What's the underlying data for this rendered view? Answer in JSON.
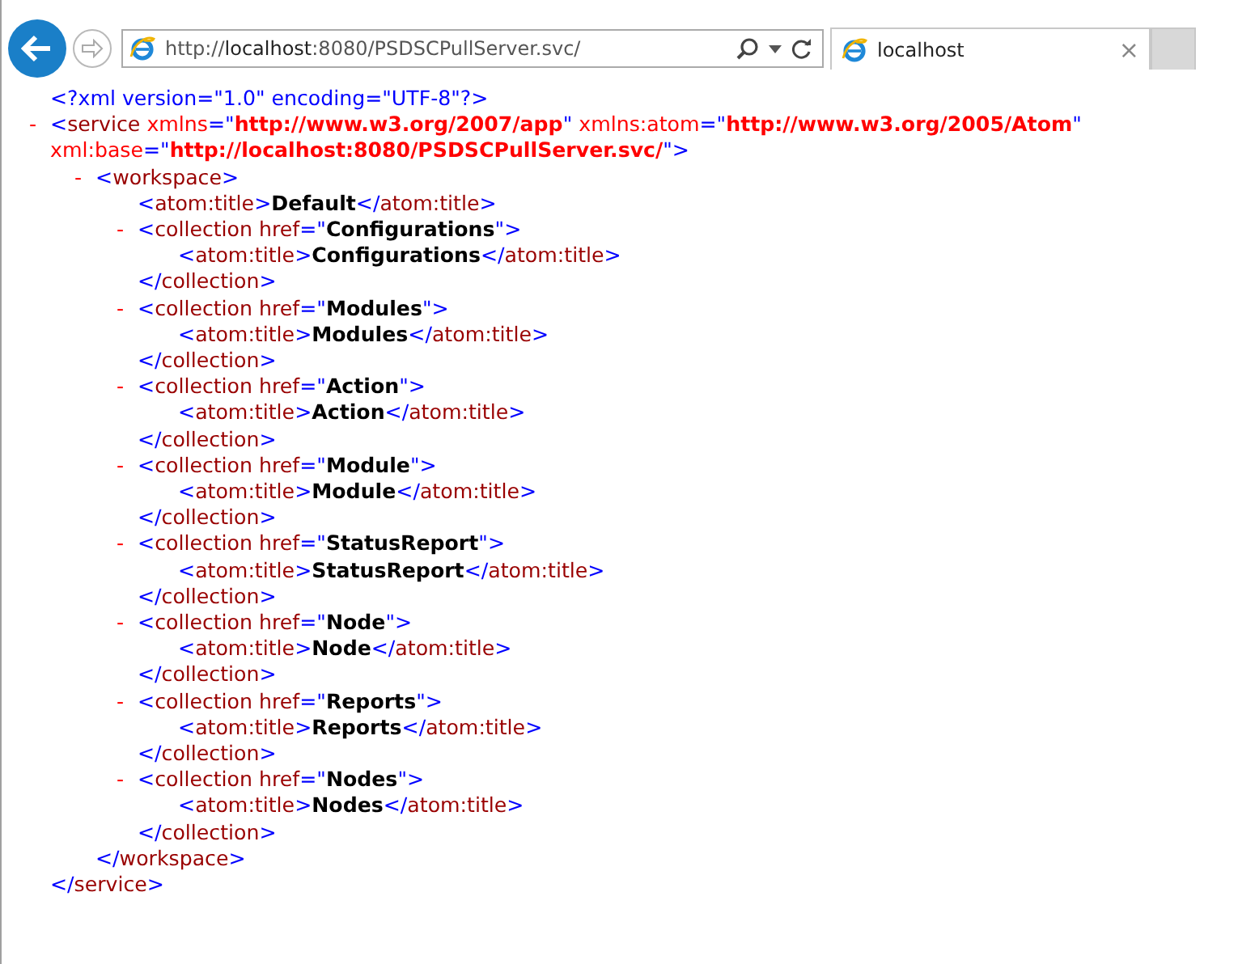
{
  "browser": {
    "address": "http://**localhost**:8080/PSDSCPullServer.svc/",
    "tabs": [
      {
        "title": "localhost",
        "close": "×",
        "selected": true
      }
    ]
  },
  "xml": {
    "declaration": "<?xml version=\"1.0\" encoding=\"UTF-8\"?>",
    "root": {
      "toggle": "-",
      "open_lines": [
        [
          {
            "kind": "punct",
            "text": "<"
          },
          {
            "kind": "name",
            "text": "service"
          },
          {
            "kind": "ns-attr",
            "text": " xmlns"
          },
          {
            "kind": "punct",
            "text": "=\""
          },
          {
            "kind": "ns-value",
            "text": "http://www.w3.org/2007/app"
          },
          {
            "kind": "punct",
            "text": "\""
          },
          {
            "kind": "ns-attr",
            "text": " xmlns:atom"
          },
          {
            "kind": "punct",
            "text": "=\""
          },
          {
            "kind": "ns-value",
            "text": "http://www.w3.org/2005/Atom"
          },
          {
            "kind": "punct",
            "text": "\""
          }
        ],
        [
          {
            "kind": "ns-attr",
            "text": "xml:base"
          },
          {
            "kind": "punct",
            "text": "=\""
          },
          {
            "kind": "ns-value",
            "text": "http://localhost:8080/PSDSCPullServer.svc/"
          },
          {
            "kind": "punct",
            "text": "\">"
          }
        ]
      ],
      "close": [
        {
          "kind": "punct",
          "text": "</"
        },
        {
          "kind": "name",
          "text": "service"
        },
        {
          "kind": "punct",
          "text": ">"
        }
      ],
      "children": [
        {
          "toggle": "-",
          "open_lines": [
            [
              {
                "kind": "punct",
                "text": "<"
              },
              {
                "kind": "name",
                "text": "workspace"
              },
              {
                "kind": "punct",
                "text": ">"
              }
            ]
          ],
          "close": [
            {
              "kind": "punct",
              "text": "</"
            },
            {
              "kind": "name",
              "text": "workspace"
            },
            {
              "kind": "punct",
              "text": ">"
            }
          ],
          "children": [
            {
              "open_lines": [
                [
                  {
                    "kind": "punct",
                    "text": "<"
                  },
                  {
                    "kind": "name",
                    "text": "atom:title"
                  },
                  {
                    "kind": "punct",
                    "text": ">"
                  },
                  {
                    "kind": "text",
                    "text": "Default"
                  },
                  {
                    "kind": "punct",
                    "text": "</"
                  },
                  {
                    "kind": "name",
                    "text": "atom:title"
                  },
                  {
                    "kind": "punct",
                    "text": ">"
                  }
                ]
              ]
            },
            {
              "toggle": "-",
              "open_lines": [
                [
                  {
                    "kind": "punct",
                    "text": "<"
                  },
                  {
                    "kind": "name",
                    "text": "collection"
                  },
                  {
                    "kind": "attr",
                    "text": " href"
                  },
                  {
                    "kind": "punct",
                    "text": "=\""
                  },
                  {
                    "kind": "value",
                    "text": "Configurations"
                  },
                  {
                    "kind": "punct",
                    "text": "\">"
                  }
                ]
              ],
              "close": [
                {
                  "kind": "punct",
                  "text": "</"
                },
                {
                  "kind": "name",
                  "text": "collection"
                },
                {
                  "kind": "punct",
                  "text": ">"
                }
              ],
              "children": [
                {
                  "open_lines": [
                    [
                      {
                        "kind": "punct",
                        "text": "<"
                      },
                      {
                        "kind": "name",
                        "text": "atom:title"
                      },
                      {
                        "kind": "punct",
                        "text": ">"
                      },
                      {
                        "kind": "text",
                        "text": "Configurations"
                      },
                      {
                        "kind": "punct",
                        "text": "</"
                      },
                      {
                        "kind": "name",
                        "text": "atom:title"
                      },
                      {
                        "kind": "punct",
                        "text": ">"
                      }
                    ]
                  ]
                }
              ]
            },
            {
              "toggle": "-",
              "open_lines": [
                [
                  {
                    "kind": "punct",
                    "text": "<"
                  },
                  {
                    "kind": "name",
                    "text": "collection"
                  },
                  {
                    "kind": "attr",
                    "text": " href"
                  },
                  {
                    "kind": "punct",
                    "text": "=\""
                  },
                  {
                    "kind": "value",
                    "text": "Modules"
                  },
                  {
                    "kind": "punct",
                    "text": "\">"
                  }
                ]
              ],
              "close": [
                {
                  "kind": "punct",
                  "text": "</"
                },
                {
                  "kind": "name",
                  "text": "collection"
                },
                {
                  "kind": "punct",
                  "text": ">"
                }
              ],
              "children": [
                {
                  "open_lines": [
                    [
                      {
                        "kind": "punct",
                        "text": "<"
                      },
                      {
                        "kind": "name",
                        "text": "atom:title"
                      },
                      {
                        "kind": "punct",
                        "text": ">"
                      },
                      {
                        "kind": "text",
                        "text": "Modules"
                      },
                      {
                        "kind": "punct",
                        "text": "</"
                      },
                      {
                        "kind": "name",
                        "text": "atom:title"
                      },
                      {
                        "kind": "punct",
                        "text": ">"
                      }
                    ]
                  ]
                }
              ]
            },
            {
              "toggle": "-",
              "open_lines": [
                [
                  {
                    "kind": "punct",
                    "text": "<"
                  },
                  {
                    "kind": "name",
                    "text": "collection"
                  },
                  {
                    "kind": "attr",
                    "text": " href"
                  },
                  {
                    "kind": "punct",
                    "text": "=\""
                  },
                  {
                    "kind": "value",
                    "text": "Action"
                  },
                  {
                    "kind": "punct",
                    "text": "\">"
                  }
                ]
              ],
              "close": [
                {
                  "kind": "punct",
                  "text": "</"
                },
                {
                  "kind": "name",
                  "text": "collection"
                },
                {
                  "kind": "punct",
                  "text": ">"
                }
              ],
              "children": [
                {
                  "open_lines": [
                    [
                      {
                        "kind": "punct",
                        "text": "<"
                      },
                      {
                        "kind": "name",
                        "text": "atom:title"
                      },
                      {
                        "kind": "punct",
                        "text": ">"
                      },
                      {
                        "kind": "text",
                        "text": "Action"
                      },
                      {
                        "kind": "punct",
                        "text": "</"
                      },
                      {
                        "kind": "name",
                        "text": "atom:title"
                      },
                      {
                        "kind": "punct",
                        "text": ">"
                      }
                    ]
                  ]
                }
              ]
            },
            {
              "toggle": "-",
              "open_lines": [
                [
                  {
                    "kind": "punct",
                    "text": "<"
                  },
                  {
                    "kind": "name",
                    "text": "collection"
                  },
                  {
                    "kind": "attr",
                    "text": " href"
                  },
                  {
                    "kind": "punct",
                    "text": "=\""
                  },
                  {
                    "kind": "value",
                    "text": "Module"
                  },
                  {
                    "kind": "punct",
                    "text": "\">"
                  }
                ]
              ],
              "close": [
                {
                  "kind": "punct",
                  "text": "</"
                },
                {
                  "kind": "name",
                  "text": "collection"
                },
                {
                  "kind": "punct",
                  "text": ">"
                }
              ],
              "children": [
                {
                  "open_lines": [
                    [
                      {
                        "kind": "punct",
                        "text": "<"
                      },
                      {
                        "kind": "name",
                        "text": "atom:title"
                      },
                      {
                        "kind": "punct",
                        "text": ">"
                      },
                      {
                        "kind": "text",
                        "text": "Module"
                      },
                      {
                        "kind": "punct",
                        "text": "</"
                      },
                      {
                        "kind": "name",
                        "text": "atom:title"
                      },
                      {
                        "kind": "punct",
                        "text": ">"
                      }
                    ]
                  ]
                }
              ]
            },
            {
              "toggle": "-",
              "open_lines": [
                [
                  {
                    "kind": "punct",
                    "text": "<"
                  },
                  {
                    "kind": "name",
                    "text": "collection"
                  },
                  {
                    "kind": "attr",
                    "text": " href"
                  },
                  {
                    "kind": "punct",
                    "text": "=\""
                  },
                  {
                    "kind": "value",
                    "text": "StatusReport"
                  },
                  {
                    "kind": "punct",
                    "text": "\">"
                  }
                ]
              ],
              "close": [
                {
                  "kind": "punct",
                  "text": "</"
                },
                {
                  "kind": "name",
                  "text": "collection"
                },
                {
                  "kind": "punct",
                  "text": ">"
                }
              ],
              "children": [
                {
                  "open_lines": [
                    [
                      {
                        "kind": "punct",
                        "text": "<"
                      },
                      {
                        "kind": "name",
                        "text": "atom:title"
                      },
                      {
                        "kind": "punct",
                        "text": ">"
                      },
                      {
                        "kind": "text",
                        "text": "StatusReport"
                      },
                      {
                        "kind": "punct",
                        "text": "</"
                      },
                      {
                        "kind": "name",
                        "text": "atom:title"
                      },
                      {
                        "kind": "punct",
                        "text": ">"
                      }
                    ]
                  ]
                }
              ]
            },
            {
              "toggle": "-",
              "open_lines": [
                [
                  {
                    "kind": "punct",
                    "text": "<"
                  },
                  {
                    "kind": "name",
                    "text": "collection"
                  },
                  {
                    "kind": "attr",
                    "text": " href"
                  },
                  {
                    "kind": "punct",
                    "text": "=\""
                  },
                  {
                    "kind": "value",
                    "text": "Node"
                  },
                  {
                    "kind": "punct",
                    "text": "\">"
                  }
                ]
              ],
              "close": [
                {
                  "kind": "punct",
                  "text": "</"
                },
                {
                  "kind": "name",
                  "text": "collection"
                },
                {
                  "kind": "punct",
                  "text": ">"
                }
              ],
              "children": [
                {
                  "open_lines": [
                    [
                      {
                        "kind": "punct",
                        "text": "<"
                      },
                      {
                        "kind": "name",
                        "text": "atom:title"
                      },
                      {
                        "kind": "punct",
                        "text": ">"
                      },
                      {
                        "kind": "text",
                        "text": "Node"
                      },
                      {
                        "kind": "punct",
                        "text": "</"
                      },
                      {
                        "kind": "name",
                        "text": "atom:title"
                      },
                      {
                        "kind": "punct",
                        "text": ">"
                      }
                    ]
                  ]
                }
              ]
            },
            {
              "toggle": "-",
              "open_lines": [
                [
                  {
                    "kind": "punct",
                    "text": "<"
                  },
                  {
                    "kind": "name",
                    "text": "collection"
                  },
                  {
                    "kind": "attr",
                    "text": " href"
                  },
                  {
                    "kind": "punct",
                    "text": "=\""
                  },
                  {
                    "kind": "value",
                    "text": "Reports"
                  },
                  {
                    "kind": "punct",
                    "text": "\">"
                  }
                ]
              ],
              "close": [
                {
                  "kind": "punct",
                  "text": "</"
                },
                {
                  "kind": "name",
                  "text": "collection"
                },
                {
                  "kind": "punct",
                  "text": ">"
                }
              ],
              "children": [
                {
                  "open_lines": [
                    [
                      {
                        "kind": "punct",
                        "text": "<"
                      },
                      {
                        "kind": "name",
                        "text": "atom:title"
                      },
                      {
                        "kind": "punct",
                        "text": ">"
                      },
                      {
                        "kind": "text",
                        "text": "Reports"
                      },
                      {
                        "kind": "punct",
                        "text": "</"
                      },
                      {
                        "kind": "name",
                        "text": "atom:title"
                      },
                      {
                        "kind": "punct",
                        "text": ">"
                      }
                    ]
                  ]
                }
              ]
            },
            {
              "toggle": "-",
              "open_lines": [
                [
                  {
                    "kind": "punct",
                    "text": "<"
                  },
                  {
                    "kind": "name",
                    "text": "collection"
                  },
                  {
                    "kind": "attr",
                    "text": " href"
                  },
                  {
                    "kind": "punct",
                    "text": "=\""
                  },
                  {
                    "kind": "value",
                    "text": "Nodes"
                  },
                  {
                    "kind": "punct",
                    "text": "\">"
                  }
                ]
              ],
              "close": [
                {
                  "kind": "punct",
                  "text": "</"
                },
                {
                  "kind": "name",
                  "text": "collection"
                },
                {
                  "kind": "punct",
                  "text": ">"
                }
              ],
              "children": [
                {
                  "open_lines": [
                    [
                      {
                        "kind": "punct",
                        "text": "<"
                      },
                      {
                        "kind": "name",
                        "text": "atom:title"
                      },
                      {
                        "kind": "punct",
                        "text": ">"
                      },
                      {
                        "kind": "text",
                        "text": "Nodes"
                      },
                      {
                        "kind": "punct",
                        "text": "</"
                      },
                      {
                        "kind": "name",
                        "text": "atom:title"
                      },
                      {
                        "kind": "punct",
                        "text": ">"
                      }
                    ]
                  ]
                }
              ]
            }
          ]
        }
      ]
    }
  }
}
